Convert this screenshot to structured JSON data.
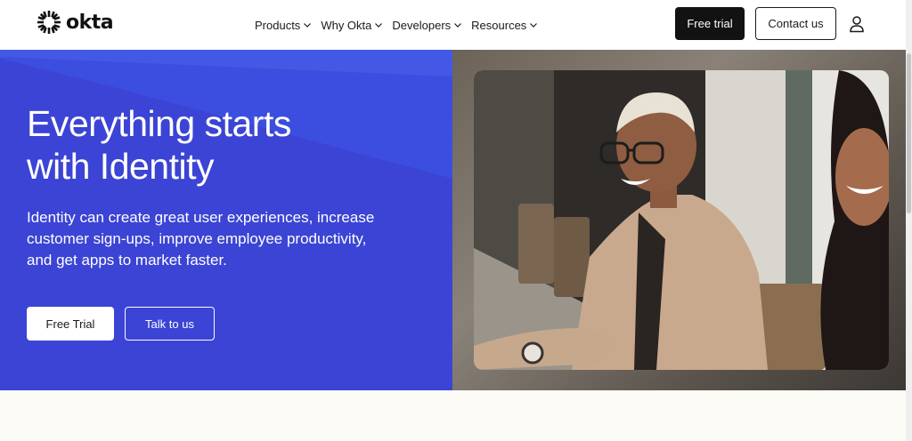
{
  "header": {
    "logo_text": "okta",
    "nav": [
      {
        "label": "Products"
      },
      {
        "label": "Why Okta"
      },
      {
        "label": "Developers"
      },
      {
        "label": "Resources"
      }
    ],
    "free_trial_label": "Free trial",
    "contact_label": "Contact us",
    "user_icon": "user-icon"
  },
  "hero": {
    "headline_line1": "Everything starts",
    "headline_line2": "with Identity",
    "subtext": "Identity can create great user experiences, increase customer sign-ups, improve employee productivity, and get apps to market faster.",
    "primary_cta": "Free Trial",
    "secondary_cta": "Talk to us",
    "photo_alt": "Smiling woman with glasses in a meeting room"
  },
  "colors": {
    "hero_blue": "#3a47d6",
    "dark_button": "#121212",
    "page_bg": "#fcfbf6"
  }
}
